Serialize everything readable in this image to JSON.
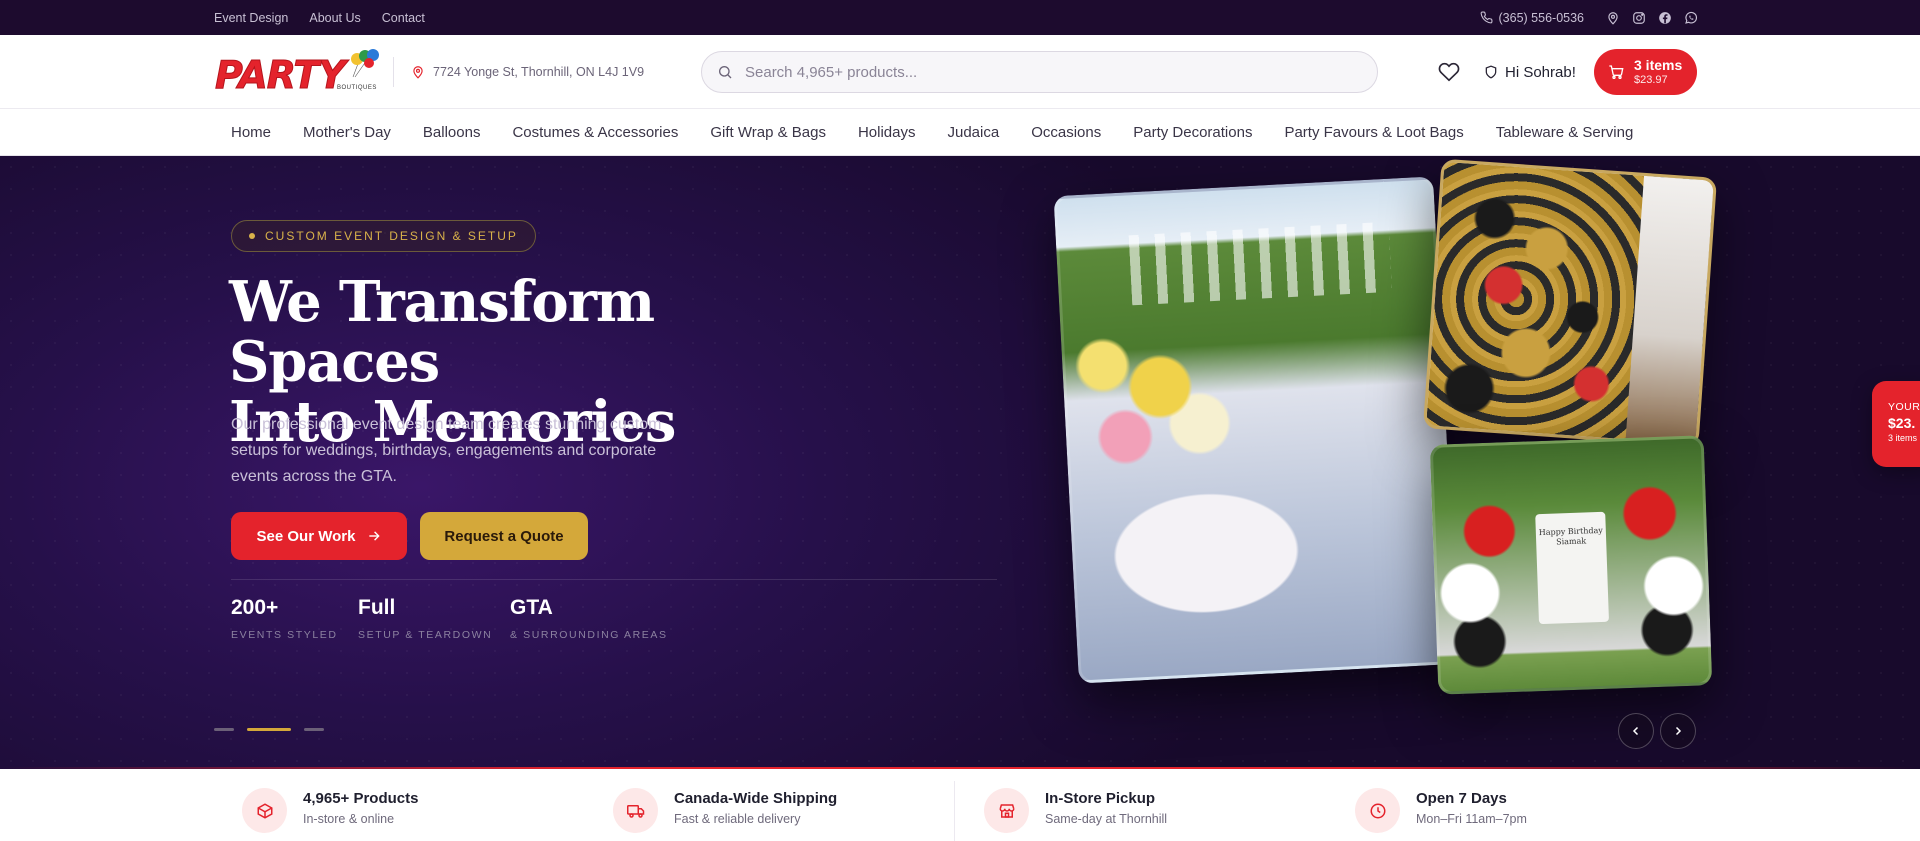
{
  "topbar": {
    "links": [
      "Event Design",
      "About Us",
      "Contact"
    ],
    "phone": "(365) 556-0536",
    "social_icons": [
      "map-pin-icon",
      "instagram-icon",
      "facebook-icon",
      "whatsapp-icon"
    ]
  },
  "header": {
    "logo_text": "PARTY",
    "logo_sub": "BOUTIQUES",
    "address": "7724 Yonge St, Thornhill, ON L4J 1V9",
    "search_placeholder": "Search 4,965+ products...",
    "greeting": "Hi Sohrab!",
    "cart_count": "3 items",
    "cart_total": "$23.97"
  },
  "nav": [
    "Home",
    "Mother's Day",
    "Balloons",
    "Costumes & Accessories",
    "Gift Wrap & Bags",
    "Holidays",
    "Judaica",
    "Occasions",
    "Party Decorations",
    "Party Favours & Loot Bags",
    "Tableware & Serving"
  ],
  "hero": {
    "badge": "CUSTOM EVENT DESIGN & SETUP",
    "headline_line1": "We Transform Spaces",
    "headline_line2": "Into Memories",
    "subtext": "Our professional event design team creates stunning custom setups for weddings, birthdays, engagements and corporate events across the GTA.",
    "primary_cta": "See Our Work",
    "secondary_cta": "Request a Quote",
    "stats": [
      {
        "value": "200+",
        "label": "EVENTS STYLED"
      },
      {
        "value": "Full",
        "label": "SETUP & TEARDOWN"
      },
      {
        "value": "GTA",
        "label": "& SURROUNDING AREAS"
      }
    ],
    "active_slide": 2,
    "slide_count": 3,
    "photo_sign_text": "Happy Birthday Siamak"
  },
  "side_cart": {
    "label": "YOUR",
    "total": "$23.",
    "count": "3 items"
  },
  "features": [
    {
      "title": "4,965+ Products",
      "desc": "In-store & online",
      "icon": "box-icon"
    },
    {
      "title": "Canada-Wide Shipping",
      "desc": "Fast & reliable delivery",
      "icon": "truck-icon"
    },
    {
      "title": "In-Store Pickup",
      "desc": "Same-day at Thornhill",
      "icon": "store-icon"
    },
    {
      "title": "Open 7 Days",
      "desc": "Mon–Fri 11am–7pm",
      "icon": "clock-icon"
    }
  ],
  "colors": {
    "brand_red": "#e4232c",
    "gold": "#d4a83a",
    "hero_bg": "#1d0b2e"
  }
}
